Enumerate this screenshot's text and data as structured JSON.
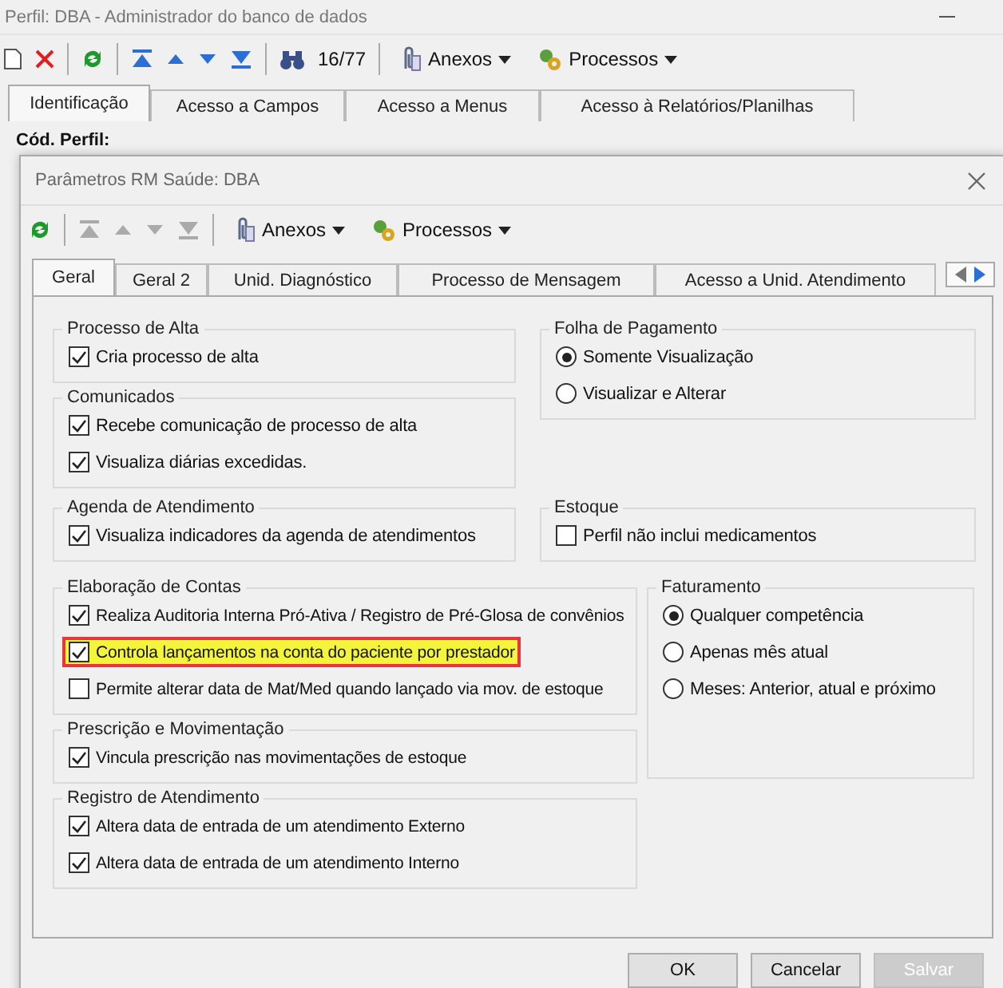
{
  "window": {
    "title": "Perfil: DBA - Administrador do banco de dados"
  },
  "toolbar": {
    "counter": "16/77",
    "menus": [
      "Anexos",
      "Processos"
    ]
  },
  "tabs": [
    {
      "label": "Identificação",
      "selected": true
    },
    {
      "label": "Acesso a Campos",
      "selected": false
    },
    {
      "label": "Acesso a Menus",
      "selected": false
    },
    {
      "label": "Acesso à Relatórios/Planilhas",
      "selected": false
    }
  ],
  "form": {
    "label": "Cód. Perfil:"
  },
  "dialog": {
    "title": "Parâmetros RM Saúde: DBA",
    "toolbar": {
      "menus": [
        "Anexos",
        "Processos"
      ]
    },
    "tabs": [
      {
        "label": "Geral",
        "selected": true
      },
      {
        "label": "Geral 2",
        "selected": false
      },
      {
        "label": "Unid. Diagnóstico",
        "selected": false
      },
      {
        "label": "Processo de Mensagem",
        "selected": false
      },
      {
        "label": "Acesso a Unid. Atendimento",
        "selected": false
      }
    ],
    "sections": [
      {
        "columns": [
          [
            {
              "title": "Processo de Alta",
              "items": [
                {
                  "kind": "checkbox",
                  "label": "Cria processo de alta",
                  "checked": true
                }
              ]
            },
            {
              "title": "Comunicados",
              "items": [
                {
                  "kind": "checkbox",
                  "label": "Recebe comunicação de processo de alta",
                  "checked": true
                },
                {
                  "kind": "checkbox",
                  "label": "Visualiza diárias excedidas.",
                  "checked": true
                }
              ]
            }
          ],
          [
            {
              "title": "Folha de Pagamento",
              "items": [
                {
                  "kind": "radio",
                  "label": "Somente Visualização",
                  "selected": true
                },
                {
                  "kind": "radio",
                  "label": "Visualizar e Alterar",
                  "selected": false
                }
              ]
            }
          ]
        ]
      },
      {
        "columns": [
          [
            {
              "title": "Agenda de Atendimento",
              "items": [
                {
                  "kind": "checkbox",
                  "label": "Visualiza indicadores da agenda de atendimentos",
                  "checked": true
                }
              ]
            }
          ],
          [
            {
              "title": "Estoque",
              "items": [
                {
                  "kind": "checkbox",
                  "label": "Perfil não inclui medicamentos",
                  "checked": false
                }
              ]
            }
          ]
        ]
      },
      {
        "columns": [
          [
            {
              "title": "Elaboração de Contas",
              "items": [
                {
                  "kind": "checkbox",
                  "label": "Realiza Auditoria Interna Pró-Ativa / Registro de Pré-Glosa de convênios",
                  "checked": true
                },
                {
                  "kind": "checkbox",
                  "label": "Controla lançamentos na conta do paciente por prestador",
                  "checked": true,
                  "highlighted": true
                },
                {
                  "kind": "checkbox",
                  "label": "Permite alterar data de Mat/Med quando lançado via mov. de estoque",
                  "checked": false
                }
              ]
            },
            {
              "title": "Prescrição e Movimentação",
              "items": [
                {
                  "kind": "checkbox",
                  "label": "Vincula prescrição nas movimentações de estoque",
                  "checked": true
                }
              ]
            },
            {
              "title": "Registro de Atendimento",
              "items": [
                {
                  "kind": "checkbox",
                  "label": "Altera data de entrada de um atendimento Externo",
                  "checked": true
                },
                {
                  "kind": "checkbox",
                  "label": "Altera data de entrada de um atendimento Interno",
                  "checked": true
                }
              ]
            }
          ],
          [
            {
              "title": "Faturamento",
              "items": [
                {
                  "kind": "radio",
                  "label": "Qualquer competência",
                  "selected": true
                },
                {
                  "kind": "radio",
                  "label": "Apenas mês atual",
                  "selected": false
                },
                {
                  "kind": "radio",
                  "label": "Meses: Anterior, atual e próximo",
                  "selected": false
                }
              ]
            }
          ]
        ]
      }
    ],
    "buttons": [
      {
        "label": "OK",
        "disabled": false
      },
      {
        "label": "Cancelar",
        "disabled": false
      },
      {
        "label": "Salvar",
        "disabled": true
      }
    ]
  }
}
